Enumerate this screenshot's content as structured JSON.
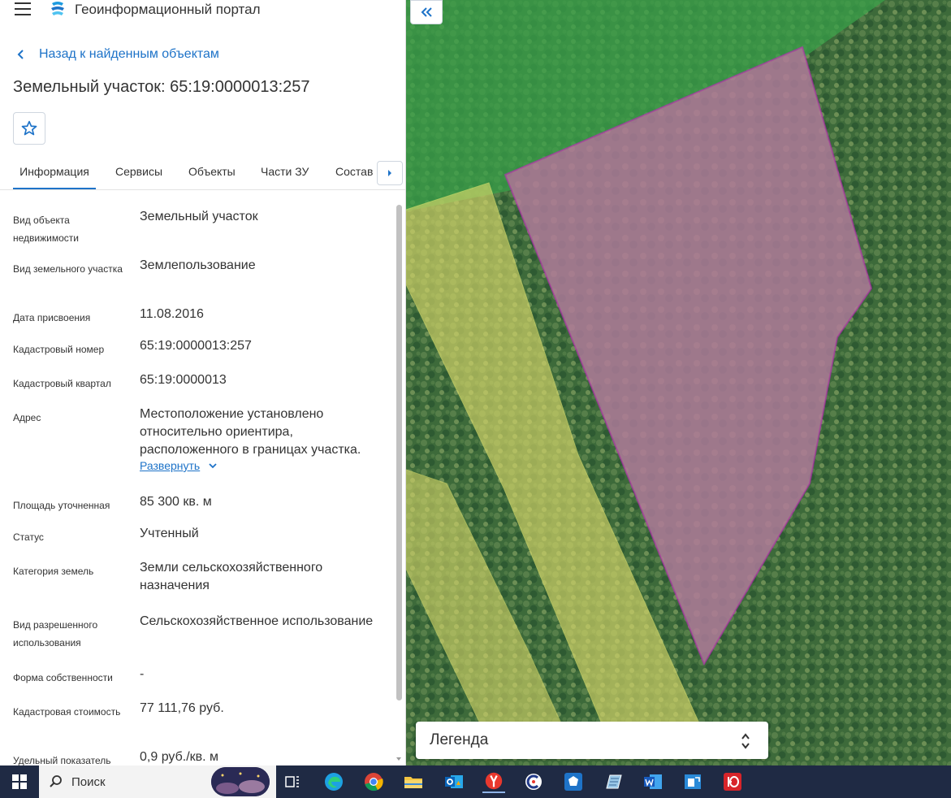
{
  "header": {
    "title": "Геоинформационный портал"
  },
  "back_link": {
    "label": "Назад к найденным объектам"
  },
  "object": {
    "title": "Земельный участок: 65:19:0000013:257"
  },
  "tabs": [
    {
      "label": "Информация"
    },
    {
      "label": "Сервисы"
    },
    {
      "label": "Объекты"
    },
    {
      "label": "Части ЗУ"
    },
    {
      "label": "Состав"
    }
  ],
  "info": {
    "rows": [
      {
        "label": "Вид объекта недвижимости",
        "value": "Земельный участок"
      },
      {
        "label": "Вид земельного участка",
        "value": "Землепользование"
      },
      {
        "label": "Дата присвоения",
        "value": "11.08.2016"
      },
      {
        "label": "Кадастровый номер",
        "value": "65:19:0000013:257"
      },
      {
        "label": "Кадастровый квартал",
        "value": "65:19:0000013"
      },
      {
        "label": "Адрес",
        "value": "Местоположение установлено относительно ориентира, расположенного в границах участка."
      },
      {
        "label": "Площадь уточненная",
        "value": "85 300 кв. м"
      },
      {
        "label": "Статус",
        "value": "Учтенный"
      },
      {
        "label": "Категория земель",
        "value": "Земли сельскохозяйственного назначения"
      },
      {
        "label": "Вид разрешенного использования",
        "value": "Сельскохозяйственное использование"
      },
      {
        "label": "Форма собственности",
        "value": "-"
      },
      {
        "label": "Кадастровая стоимость",
        "value": "77 111,76 руб."
      },
      {
        "label": "Удельный показатель",
        "value": "0,9 руб./кв. м"
      }
    ],
    "expand_label": "Развернуть"
  },
  "map": {
    "legend_label": "Легенда"
  },
  "taskbar": {
    "search_label": "Поиск"
  },
  "colors": {
    "accent": "#1e73c8",
    "parcel_stroke": "#c21fc8",
    "parcel_fill": "#b06ab4",
    "field_fill": "#d8d86a",
    "green_zone": "#3aa04a"
  }
}
